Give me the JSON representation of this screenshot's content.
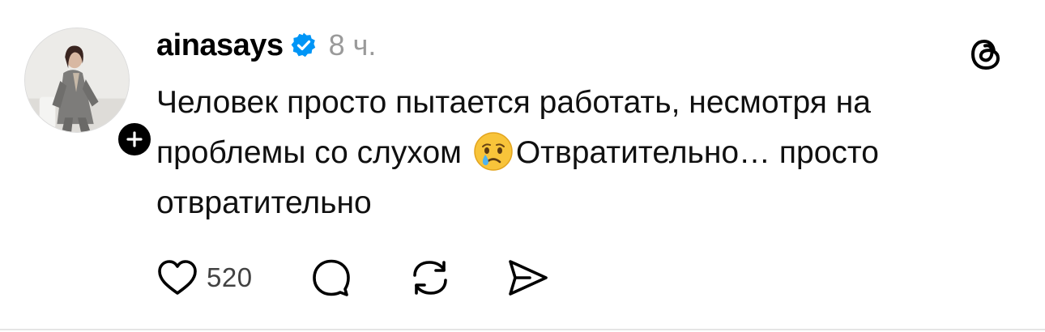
{
  "post": {
    "username": "ainasays",
    "time": "8 ч.",
    "text_line1": "Человек просто пытается работать, несмотря на",
    "text_line2a": "проблемы со слухом ",
    "text_line2b": "Отвратительно… просто",
    "text_line3": "отвратительно",
    "likes": "520"
  },
  "icons": {
    "verified": "verified-badge-icon",
    "app_logo": "threads-logo-icon",
    "emoji": "crying-face-emoji",
    "like": "heart-icon",
    "reply": "comment-bubble-icon",
    "repost": "repost-icon",
    "share": "send-icon",
    "follow": "plus-icon"
  },
  "colors": {
    "verified_blue": "#0095f6",
    "muted_gray": "#9a9a9a"
  }
}
